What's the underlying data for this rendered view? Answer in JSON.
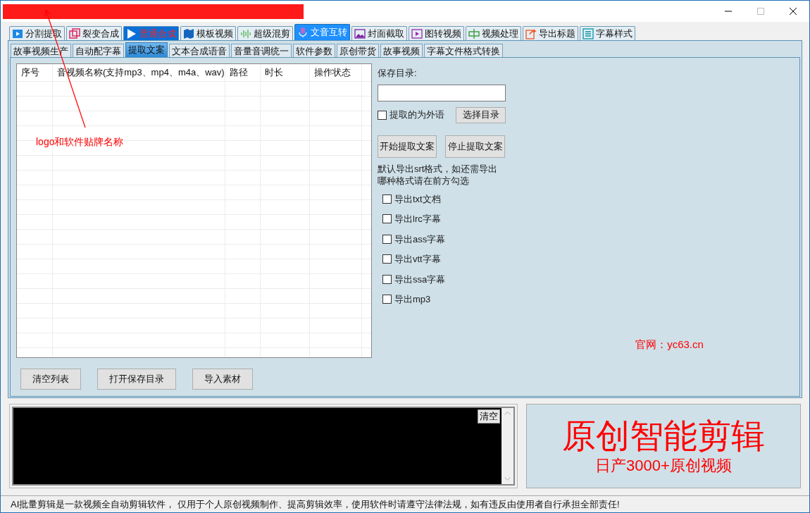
{
  "annotation": {
    "text": "logo和软件贴牌名称"
  },
  "tabs": [
    {
      "label": "分割提取",
      "selected": false,
      "kind": "normal"
    },
    {
      "label": "裂变合成",
      "selected": false,
      "kind": "normal"
    },
    {
      "label": "普通合成",
      "selected": false,
      "kind": "accent"
    },
    {
      "label": "模板视频",
      "selected": false,
      "kind": "normal"
    },
    {
      "label": "超级混剪",
      "selected": false,
      "kind": "normal"
    },
    {
      "label": "文音互转",
      "selected": true,
      "kind": "normal"
    },
    {
      "label": "封面截取",
      "selected": false,
      "kind": "normal"
    },
    {
      "label": "图转视频",
      "selected": false,
      "kind": "normal"
    },
    {
      "label": "视频处理",
      "selected": false,
      "kind": "normal"
    },
    {
      "label": "导出标题",
      "selected": false,
      "kind": "normal"
    },
    {
      "label": "字幕样式",
      "selected": false,
      "kind": "normal"
    }
  ],
  "subtabs": [
    {
      "label": "故事视频生产",
      "selected": false
    },
    {
      "label": "自动配字幕",
      "selected": false
    },
    {
      "label": "提取文案",
      "selected": true
    },
    {
      "label": "文本合成语音",
      "selected": false
    },
    {
      "label": "音量音调统一",
      "selected": false
    },
    {
      "label": "软件参数",
      "selected": false
    },
    {
      "label": "原创带货",
      "selected": false
    },
    {
      "label": "故事视频",
      "selected": false
    },
    {
      "label": "字幕文件格式转换",
      "selected": false
    }
  ],
  "table": {
    "columns": [
      "序号",
      "音视频名称(支持mp3、mp4、m4a、wav)",
      "路径",
      "时长",
      "操作状态"
    ]
  },
  "settings": {
    "save_dir_label": "保存目录:",
    "foreign": {
      "label": "提取的为外语",
      "checked": false
    },
    "choose_button": "选择目录",
    "start_button": "开始提取文案",
    "stop_button": "停止提取文案",
    "note": "默认导出srt格式，如还需导出哪种格式请在前方勾选",
    "exports": [
      {
        "label": "导出txt文档",
        "checked": false
      },
      {
        "label": "导出lrc字幕",
        "checked": false
      },
      {
        "label": "导出ass字幕",
        "checked": false
      },
      {
        "label": "导出vtt字幕",
        "checked": false
      },
      {
        "label": "导出ssa字幕",
        "checked": false
      },
      {
        "label": "导出mp3",
        "checked": false
      }
    ]
  },
  "website": "官网：yc63.cn",
  "buttons": [
    "清空列表",
    "打开保存目录",
    "导入素材"
  ],
  "log": {
    "clear_button": "清空"
  },
  "promo": {
    "title": "原创智能剪辑",
    "subtitle": "日产3000+原创视频"
  },
  "status_bar": "AI批量剪辑是一款视频全自动剪辑软件， 仅用于个人原创视频制作、提高剪辑效率，使用软件时请遵守法律法规，如有违反由使用者自行承担全部责任!"
}
